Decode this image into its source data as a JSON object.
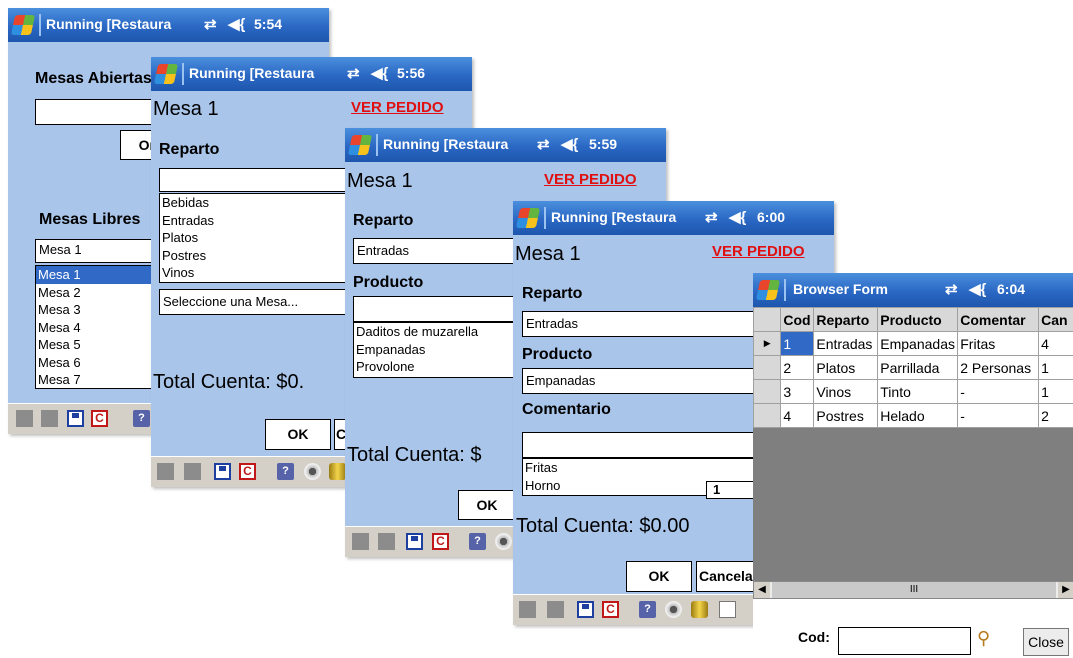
{
  "w1": {
    "title": "Running [Restaura",
    "time": "5:54",
    "open_tables_label": "Mesas Abiertas",
    "button_label": "Or",
    "free_tables_label": "Mesas Libres",
    "combo_value": "Mesa 1",
    "items": [
      "Mesa 1",
      "Mesa 2",
      "Mesa 3",
      "Mesa 4",
      "Mesa 5",
      "Mesa 6",
      "Mesa 7"
    ]
  },
  "w2": {
    "title": "Running [Restaura",
    "time": "5:56",
    "mesa": "Mesa 1",
    "ver_pedido": "VER PEDIDO",
    "reparto_label": "Reparto",
    "items": [
      "Bebidas",
      "Entradas",
      "Platos",
      "Postres",
      "Vinos"
    ],
    "combo_value": "Seleccione una Mesa...",
    "total": "Total Cuenta: $0.",
    "ok": "OK",
    "cancel_partial": "C"
  },
  "w3": {
    "title": "Running [Restaura",
    "time": "5:59",
    "mesa": "Mesa 1",
    "ver_pedido": "VER PEDIDO",
    "reparto_label": "Reparto",
    "reparto_value": "Entradas",
    "producto_label": "Producto",
    "items": [
      "Daditos de muzarella",
      "Empanadas",
      "Provolone"
    ],
    "total": "Total Cuenta: $",
    "ok": "OK"
  },
  "w4": {
    "title": "Running [Restaura",
    "time": "6:00",
    "mesa": "Mesa 1",
    "ver_pedido": "VER PEDIDO",
    "reparto_label": "Reparto",
    "reparto_value": "Entradas",
    "producto_label": "Producto",
    "producto_value": "Empanadas",
    "comentario_label": "Comentario",
    "items": [
      "Fritas",
      "Horno"
    ],
    "qty": "1",
    "total": "Total Cuenta: $0.00",
    "ok": "OK",
    "cancel": "Cancela"
  },
  "w5": {
    "title": "Browser Form",
    "time": "6:04",
    "columns": [
      "Cod",
      "Reparto",
      "Producto",
      "Comentar",
      "Can"
    ],
    "rows": [
      [
        "1",
        "Entradas",
        "Empanadas",
        "Fritas",
        "4"
      ],
      [
        "2",
        "Platos",
        "Parrillada",
        "2 Personas",
        "1"
      ],
      [
        "3",
        "Vinos",
        "Tinto",
        "-",
        "1"
      ],
      [
        "4",
        "Postres",
        "Helado",
        "-",
        "2"
      ]
    ],
    "scroll_grip": "III",
    "cod_label": "Cod:",
    "cod_value": "",
    "close": "Close"
  },
  "icons": {
    "start": "windows-flag-icon",
    "connectivity": "connectivity-icon",
    "volume": "speaker-icon",
    "search": "magnifier-icon"
  }
}
